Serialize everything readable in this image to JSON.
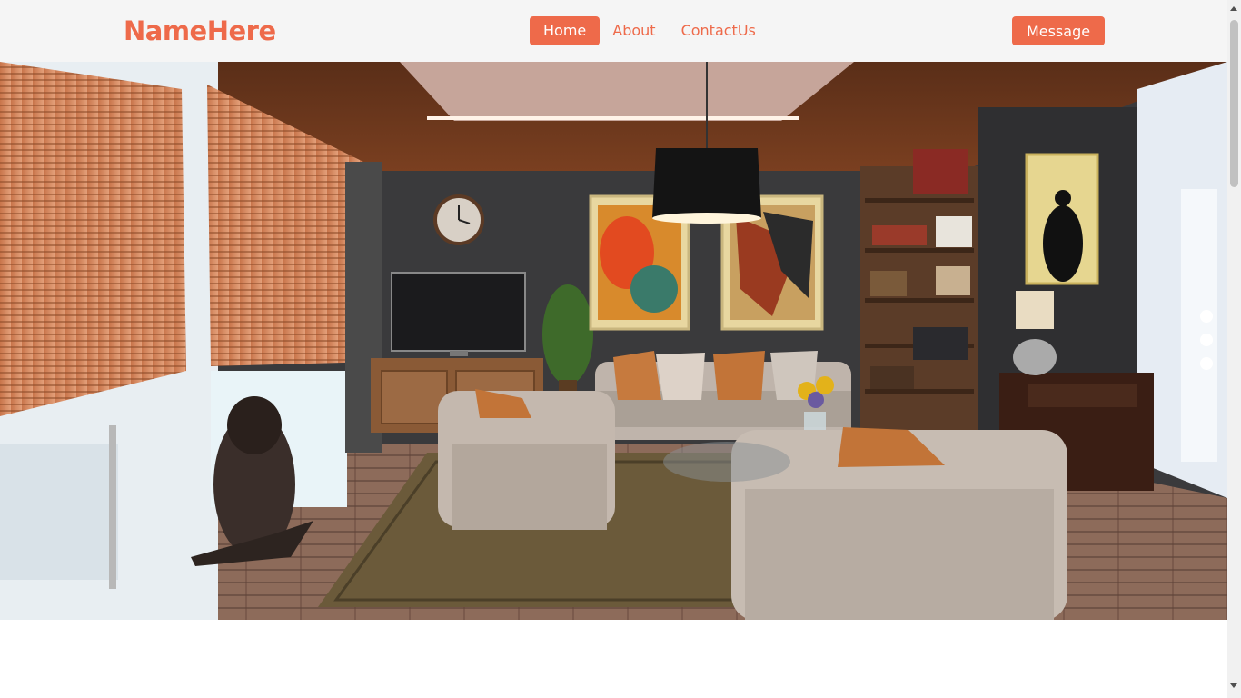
{
  "brand": {
    "name": "NameHere"
  },
  "nav": {
    "items": [
      {
        "label": "Home",
        "active": true
      },
      {
        "label": "About",
        "active": false
      },
      {
        "label": "ContactUs",
        "active": false
      }
    ]
  },
  "header": {
    "message_label": "Message"
  },
  "hero": {
    "image": "living-room-interior",
    "slides": 3
  },
  "colors": {
    "accent": "#ee6a4a",
    "navbar_bg": "#f5f5f5",
    "page_bg": "#ffffff"
  }
}
